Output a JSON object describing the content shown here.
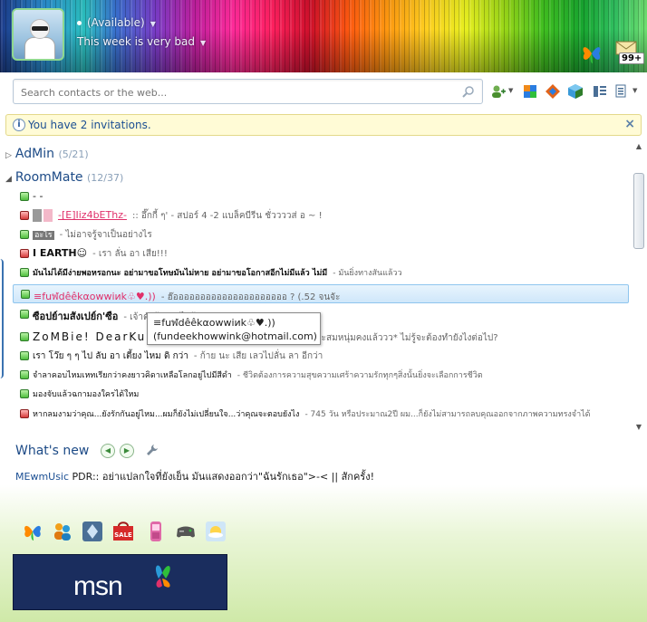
{
  "header": {
    "status": "(Available)",
    "personal_message": "This week is very bad",
    "mail_count": "99+"
  },
  "search": {
    "placeholder": "Search contacts or the web..."
  },
  "toolbar": {
    "icons": [
      "add-contact-icon",
      "sharing-icon",
      "activities-icon",
      "games-icon",
      "layout-icon",
      "menu-icon"
    ]
  },
  "invitations": {
    "text": "You have 2 invitations."
  },
  "groups": [
    {
      "name": "AdMin",
      "count": "(5/21)",
      "expanded": false
    },
    {
      "name": "RoomMate",
      "count": "(12/37)",
      "expanded": true
    }
  ],
  "contacts": [
    {
      "status": "online",
      "name": "- -",
      "psm": ""
    },
    {
      "status": "busy",
      "name": "-[E]Iiz4bEThz-",
      "psm": ":: อึ๊กกี้ ๆ' - สปอร์ 4 -2 แบล็คบีรีน ชั่ววววส่ อ ~ !"
    },
    {
      "status": "online",
      "name": "อะไร",
      "psm": "- ไม่อาจรู้จาเป็นอย่างไร"
    },
    {
      "status": "busy",
      "name": "I  EARTH☺",
      "psm": "- เรา ลั่น อา เสีย!!!"
    },
    {
      "status": "online",
      "name": "มันไม่ได้มีง่ายพอหรอกนะ อย่ามาขอโทษมันไม่หาย อย่ามาขอโอกาสอีกไม่มีแล้ว ไม่มี",
      "psm": "- มันยิ่งทางสันแล้วว"
    },
    {
      "status": "online",
      "name": "≡fuฬdêêkαowwiиk♧♥.))",
      "psm": "- ฮ๊อออออออออออออออออออออ ? (.52 จนจัะ"
    },
    {
      "status": "online",
      "name": "ซือปย์ามสังเปย์ก'ซือ",
      "psm": "- เจ้าตัวรู้สึกอะไรบ้าง"
    },
    {
      "status": "online",
      "name": "ZoMBie!  DearKu",
      "psm": "...และจะสมหนุ่มคงแล้ววว*          ไม่รู้จะต้องทำยังไงต่อไป?"
    },
    {
      "status": "online",
      "name": "เรา โว๊ย ๆ ๆ ไป ลับ อา เตี้ยง ไหม ดิ กว่า",
      "psm": "- ก้าย นะ เสีย เลวไปลั่น ลา อีกว่า"
    },
    {
      "status": "online",
      "name": "จำลาคอบไหมเหทเรียกว่าคงยาวคิดาเหลือโลกอยู่ไปมีสีดำ",
      "psm": "- ชีวิตต้องการความสุขความเศร้าความรักทุกๆสิ่งนั้นยิ่งจะเลือกการชีวิต"
    },
    {
      "status": "online",
      "name": "มองจับแล้วฉกามองใครได้ใหม",
      "psm": ""
    },
    {
      "status": "busy",
      "name": "หากลมงามว่าคุณ...ยังรักกันอยู่ไหม...ผมก็ยังไม่เปลี่ยนใจ...ว่าคุณจะตอบยังไง",
      "psm": "- 745 วัน หรือประมาณ2ปี ผม...ก็ยังไม่สามารถลบคุณออกจากภาพความทรงจำได้"
    }
  ],
  "tooltip": {
    "name": "≡fuฬdêêkαowwiиk♧♥.))",
    "email": "(fundeekhowwink@hotmail.com)"
  },
  "whats_new": {
    "title": "What's new",
    "who": "MEwmUsic",
    "text": "PDR:: อย่าแปลกใจที่ยังเย็น มันแสดงออกว่า\"ฉันรักเธอ\">-< || สักครั้ง!"
  },
  "ad": {
    "logo_text": "msn"
  },
  "colors": {
    "accent": "#1c4a86",
    "invite_bg": "#fffbd6",
    "selected_row": "#cfe7fa"
  }
}
